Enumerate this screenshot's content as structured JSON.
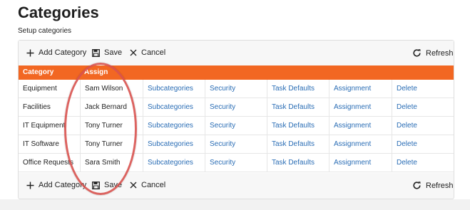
{
  "page": {
    "title": "Categories",
    "subtitle": "Setup categories"
  },
  "toolbar": {
    "add_label": "Add Category",
    "save_label": "Save",
    "cancel_label": "Cancel",
    "refresh_label": "Refresh"
  },
  "grid": {
    "columns": [
      "Category",
      "Assign"
    ],
    "rows": [
      {
        "category": "Equipment",
        "assign": "Sam Wilson",
        "subcategories": "Subcategories",
        "security": "Security",
        "task_defaults": "Task Defaults",
        "assignment": "Assignment",
        "delete": "Delete"
      },
      {
        "category": "Facilities",
        "assign": "Jack Bernard",
        "subcategories": "Subcategories",
        "security": "Security",
        "task_defaults": "Task Defaults",
        "assignment": "Assignment",
        "delete": "Delete"
      },
      {
        "category": "IT Equipment",
        "assign": "Tony Turner",
        "subcategories": "Subcategories",
        "security": "Security",
        "task_defaults": "Task Defaults",
        "assignment": "Assignment",
        "delete": "Delete"
      },
      {
        "category": "IT Software",
        "assign": "Tony Turner",
        "subcategories": "Subcategories",
        "security": "Security",
        "task_defaults": "Task Defaults",
        "assignment": "Assignment",
        "delete": "Delete"
      },
      {
        "category": "Office Requests",
        "assign": "Sara Smith",
        "subcategories": "Subcategories",
        "security": "Security",
        "task_defaults": "Task Defaults",
        "assignment": "Assignment",
        "delete": "Delete"
      }
    ]
  },
  "icons": {
    "add": "plus-icon",
    "save": "floppy-disk-icon",
    "cancel": "close-icon",
    "refresh": "refresh-icon"
  },
  "colors": {
    "header_bg": "#f26722",
    "link": "#2a6db5",
    "annotation": "#d9534f"
  }
}
